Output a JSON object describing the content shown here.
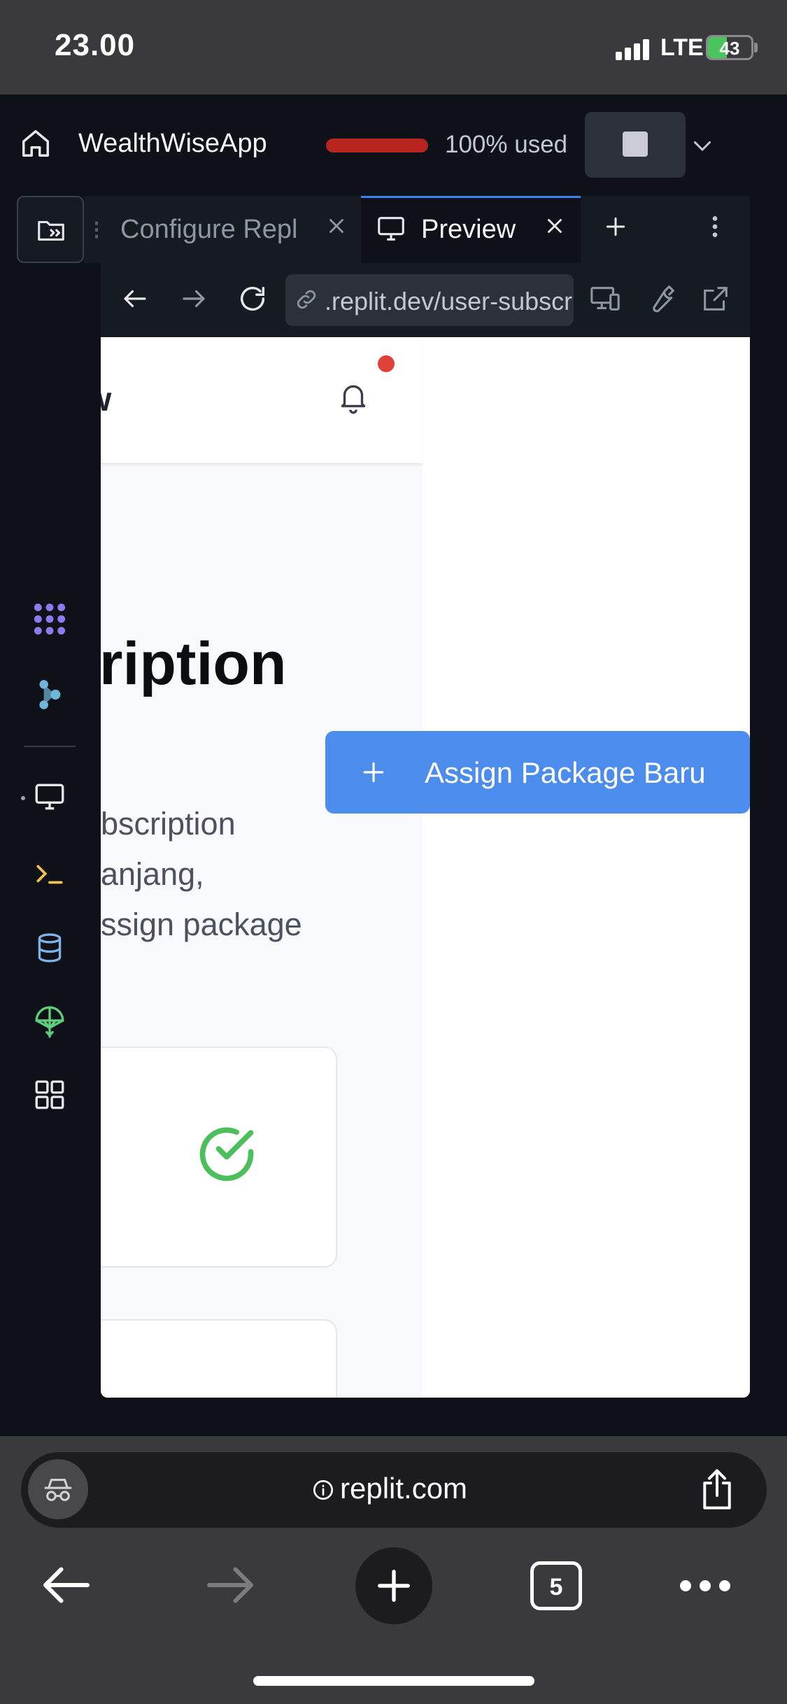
{
  "status_bar": {
    "time": "23.00",
    "network": "LTE",
    "battery_percent": 43,
    "battery_label": "43"
  },
  "replit": {
    "app_name": "WealthWiseApp",
    "usage_fraction": 1.0,
    "usage_label": "100% used",
    "tabs": [
      {
        "label": "Configure Repl",
        "active": false
      },
      {
        "label": "Preview",
        "active": true
      }
    ],
    "url": ".replit.dev/user-subscriptions",
    "rail_icons": [
      "agent-icon",
      "assistant-icon",
      "preview-icon",
      "shell-icon",
      "database-icon",
      "deployments-icon",
      "all-tools-icon"
    ]
  },
  "preview": {
    "header_title": "w",
    "page_heading": "ription",
    "description": "bscription\nanjang,\nssign package",
    "assign_button_label": "Assign Package Baru"
  },
  "safari": {
    "domain": "replit.com",
    "tab_count": "5"
  },
  "colors": {
    "accent": "#4b8cec",
    "usage": "#b8251f",
    "success": "#4cbf5c",
    "notification": "#e0403a"
  }
}
